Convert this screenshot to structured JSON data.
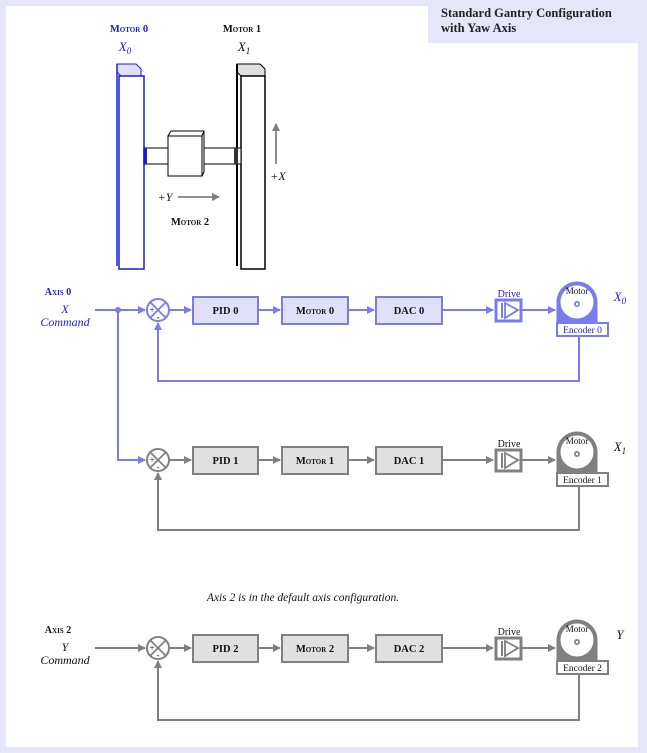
{
  "title": {
    "line1": "Standard Gantry Configuration",
    "line2": "with Yaw Axis"
  },
  "colors": {
    "background": "#e6e6fa",
    "panel": "#ffffff",
    "axis0_accent": "#7b7bf0",
    "axis0_box_fill": "#e0e0fa",
    "axis0_motor_label": "#1a1ae0",
    "gray_line": "#808080",
    "gray_box_fill": "#e0e0e0",
    "text": "#111111"
  },
  "gantry": {
    "motor0_label": "Motor 0",
    "motor0_axis": "X",
    "motor0_sub": "0",
    "motor1_label": "Motor 1",
    "motor1_axis": "X",
    "motor1_sub": "1",
    "motor2_label": "Motor 2",
    "plus_y": "+Y",
    "plus_x": "+X"
  },
  "loops": [
    {
      "axis_label": "Axis 0",
      "command_var": "X",
      "command_word": "Command",
      "sum_plus": "+",
      "sum_minus": "-",
      "pid": "PID 0",
      "motor": "Motor 0",
      "dac": "DAC 0",
      "drive": "Drive",
      "motor_icon": "Motor",
      "encoder": "Encoder 0",
      "output_var": "X",
      "output_sub": "0",
      "style": "blue"
    },
    {
      "axis_label": "",
      "command_var": "",
      "command_word": "",
      "sum_plus": "+",
      "sum_minus": "-",
      "pid": "PID 1",
      "motor": "Motor 1",
      "dac": "DAC 1",
      "drive": "Drive",
      "motor_icon": "Motor",
      "encoder": "Encoder 1",
      "output_var": "X",
      "output_sub": "1",
      "style": "gray"
    },
    {
      "axis_label": "Axis 2",
      "command_var": "Y",
      "command_word": "Command",
      "sum_plus": "+",
      "sum_minus": "-",
      "pid": "PID 2",
      "motor": "Motor 2",
      "dac": "DAC 2",
      "drive": "Drive",
      "motor_icon": "Motor",
      "encoder": "Encoder 2",
      "output_var": "Y",
      "output_sub": "",
      "style": "gray"
    }
  ],
  "caption": "Axis 2 is in the default axis configuration."
}
